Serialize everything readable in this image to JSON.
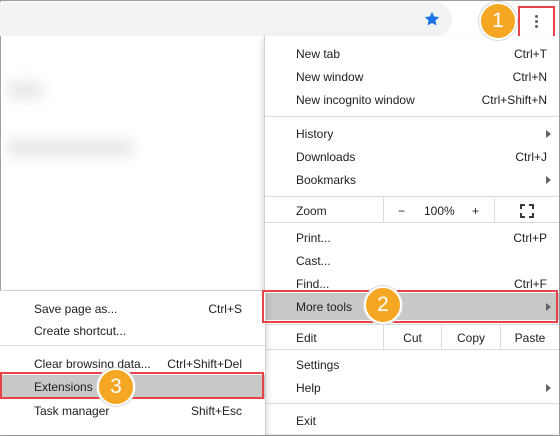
{
  "colors": {
    "highlight": "#e8424a",
    "badge": "#f5a623",
    "star": "#1a73e8",
    "hover": "#c8c8c8"
  },
  "icons": [
    "star-icon",
    "more-vert-icon",
    "fullscreen-icon",
    "chevron-right-icon"
  ],
  "badges": [
    "1",
    "2",
    "3"
  ],
  "main_menu": {
    "new_tab": {
      "label": "New tab",
      "shortcut": "Ctrl+T"
    },
    "new_window": {
      "label": "New window",
      "shortcut": "Ctrl+N"
    },
    "new_incognito": {
      "label": "New incognito window",
      "shortcut": "Ctrl+Shift+N"
    },
    "history": {
      "label": "History"
    },
    "downloads": {
      "label": "Downloads",
      "shortcut": "Ctrl+J"
    },
    "bookmarks": {
      "label": "Bookmarks"
    },
    "zoom": {
      "label": "Zoom",
      "minus": "−",
      "level": "100%",
      "plus": "+"
    },
    "print": {
      "label": "Print...",
      "shortcut": "Ctrl+P"
    },
    "cast": {
      "label": "Cast..."
    },
    "find": {
      "label": "Find...",
      "shortcut": "Ctrl+F"
    },
    "more_tools": {
      "label": "More tools"
    },
    "edit": {
      "label": "Edit",
      "cut": "Cut",
      "copy": "Copy",
      "paste": "Paste"
    },
    "settings": {
      "label": "Settings"
    },
    "help": {
      "label": "Help"
    },
    "exit": {
      "label": "Exit"
    }
  },
  "sub_menu": {
    "save_page": {
      "label": "Save page as...",
      "shortcut": "Ctrl+S"
    },
    "create_shortcut": {
      "label": "Create shortcut..."
    },
    "clear_browsing": {
      "label": "Clear browsing data...",
      "shortcut": "Ctrl+Shift+Del"
    },
    "extensions": {
      "label": "Extensions"
    },
    "task_manager": {
      "label": "Task manager",
      "shortcut": "Shift+Esc"
    }
  }
}
